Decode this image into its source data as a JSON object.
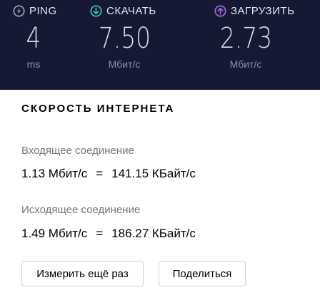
{
  "stats": {
    "ping": {
      "label": "PING",
      "value": "4",
      "unit": "ms",
      "icon": "ping-icon",
      "color": "#9a9eb3"
    },
    "download": {
      "label": "СКАЧАТЬ",
      "value": "7.50",
      "unit": "Мбит/с",
      "icon": "download-arrow-icon",
      "color": "#3fbfb5"
    },
    "upload": {
      "label": "ЗАГРУЗИТЬ",
      "value": "2.73",
      "unit": "Мбит/с",
      "icon": "upload-arrow-icon",
      "color": "#a66bd6"
    }
  },
  "result": {
    "title": "СКОРОСТЬ ИНТЕРНЕТА",
    "incoming": {
      "label": "Входящее соединение",
      "mbit": "1.13 Мбит/с",
      "equals": "=",
      "kbyte": "141.15 КБайт/с"
    },
    "outgoing": {
      "label": "Исходящее соединение",
      "mbit": "1.49 Мбит/с",
      "equals": "=",
      "kbyte": "186.27 КБайт/с"
    },
    "buttons": {
      "retest": "Измерить ещё раз",
      "share": "Поделиться"
    }
  },
  "colors": {
    "panel_background": "#151933",
    "card_background": "#ffffff"
  }
}
